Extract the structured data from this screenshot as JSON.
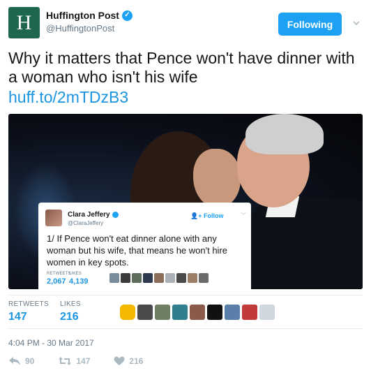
{
  "header": {
    "logo_letter": "H",
    "display_name": "Huffington Post",
    "handle": "@HuffingtonPost",
    "follow_label": "Following"
  },
  "tweet": {
    "text": "Why it matters that Pence won't have dinner with a woman who isn't his wife",
    "link": "huff.to/2mTDzB3"
  },
  "embedded_tweet": {
    "display_name": "Clara Jeffery",
    "handle": "@ClaraJeffery",
    "follow_label": "Follow",
    "text": "1/ If Pence won't eat dinner alone with any woman but his wife, that means he won't hire women in key spots.",
    "retweets_label": "RETWEETS",
    "retweets": "2,067",
    "likes_label": "LIKES",
    "likes": "4,139"
  },
  "stats": {
    "retweets_label": "RETWEETS",
    "retweets": "147",
    "likes_label": "LIKES",
    "likes": "216"
  },
  "timestamp": "4:04 PM - 30 Mar 2017",
  "actions": {
    "reply_count": "90",
    "retweet_count": "147",
    "like_count": "216"
  },
  "colors": {
    "brand_green": "#1f6650",
    "twitter_blue": "#1da1f2",
    "link_blue": "#1b95e0",
    "muted": "#657786"
  }
}
